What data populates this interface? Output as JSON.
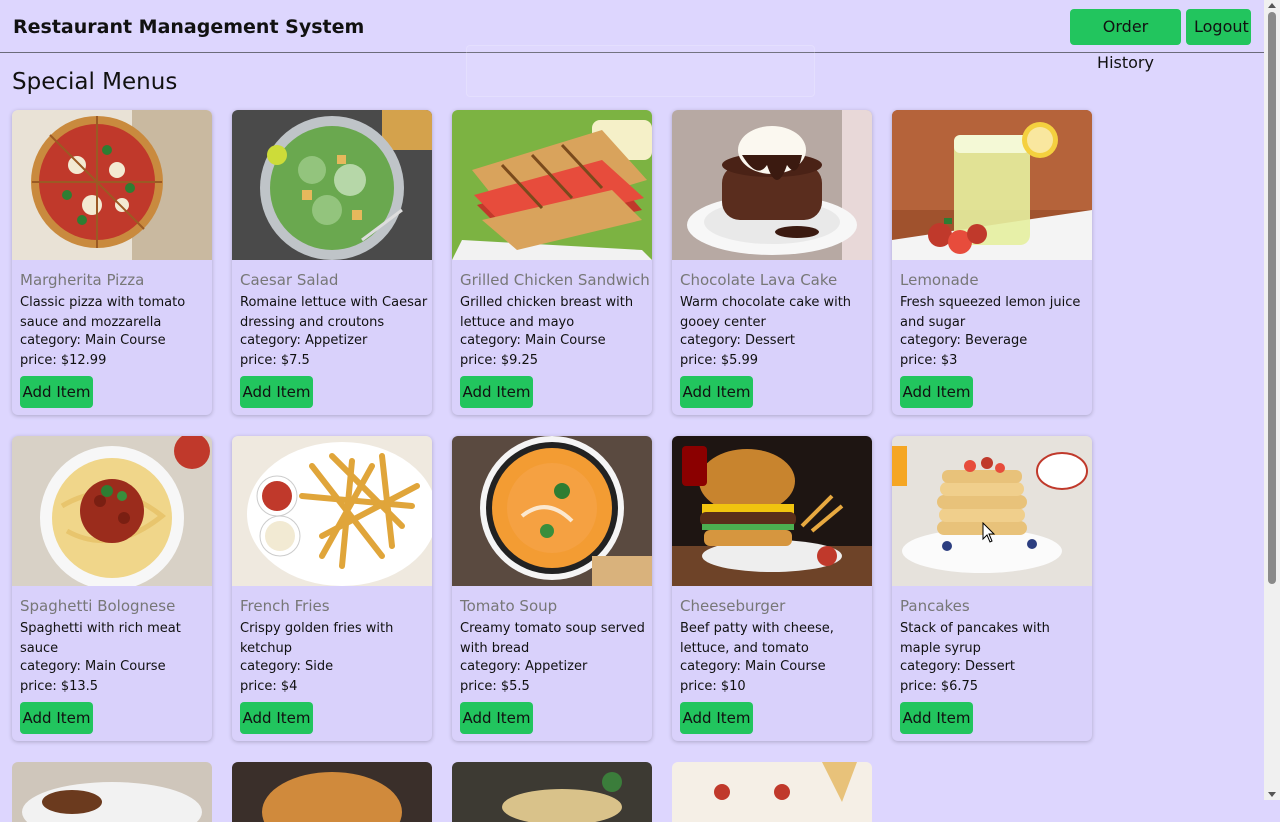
{
  "header": {
    "title": "Restaurant Management System",
    "order_history_label": "Order History",
    "logout_label": "Logout"
  },
  "section_title": "Special Menus",
  "items": [
    {
      "name": "Margherita Pizza",
      "description": "Classic pizza with tomato sauce and mozzarella",
      "category": "category: Main Course",
      "price": "price: $12.99",
      "button": "Add Item",
      "image_icon": "pizza-image-icon"
    },
    {
      "name": "Caesar Salad",
      "description": "Romaine lettuce with Caesar dressing and croutons",
      "category": "category: Appetizer",
      "price": "price: $7.5",
      "button": "Add Item",
      "image_icon": "salad-image-icon"
    },
    {
      "name": "Grilled Chicken Sandwich",
      "description": "Grilled chicken breast with lettuce and mayo",
      "category": "category: Main Course",
      "price": "price: $9.25",
      "button": "Add Item",
      "image_icon": "sandwich-image-icon"
    },
    {
      "name": "Chocolate Lava Cake",
      "description": "Warm chocolate cake with gooey center",
      "category": "category: Dessert",
      "price": "price: $5.99",
      "button": "Add Item",
      "image_icon": "cake-image-icon"
    },
    {
      "name": "Lemonade",
      "description": "Fresh squeezed lemon juice and sugar",
      "category": "category: Beverage",
      "price": "price: $3",
      "button": "Add Item",
      "image_icon": "lemonade-image-icon"
    },
    {
      "name": "Spaghetti Bolognese",
      "description": "Spaghetti with rich meat sauce",
      "category": "category: Main Course",
      "price": "price: $13.5",
      "button": "Add Item",
      "image_icon": "spaghetti-image-icon"
    },
    {
      "name": "French Fries",
      "description": "Crispy golden fries with ketchup",
      "category": "category: Side",
      "price": "price: $4",
      "button": "Add Item",
      "image_icon": "fries-image-icon"
    },
    {
      "name": "Tomato Soup",
      "description": "Creamy tomato soup served with bread",
      "category": "category: Appetizer",
      "price": "price: $5.5",
      "button": "Add Item",
      "image_icon": "soup-image-icon"
    },
    {
      "name": "Cheeseburger",
      "description": "Beef patty with cheese, lettuce, and tomato",
      "category": "category: Main Course",
      "price": "price: $10",
      "button": "Add Item",
      "image_icon": "burger-image-icon"
    },
    {
      "name": "Pancakes",
      "description": "Stack of pancakes with maple syrup",
      "category": "category: Dessert",
      "price": "price: $6.75",
      "button": "Add Item",
      "image_icon": "pancakes-image-icon"
    }
  ],
  "colors": {
    "background": "#ddd6fe",
    "card": "#d9d1fb",
    "button": "#22c55e"
  }
}
